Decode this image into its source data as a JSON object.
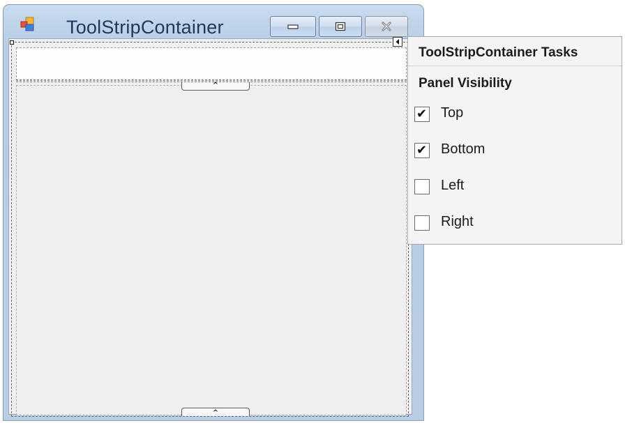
{
  "window": {
    "title": "ToolStripContainer",
    "icon": "form-icon"
  },
  "caption_buttons": {
    "minimize_icon": "minimize-icon",
    "maximize_icon": "maximize-icon",
    "close_icon": "close-icon"
  },
  "designer": {
    "top_expander_icon": "chevron-up-icon",
    "bottom_expander_icon": "chevron-up-icon",
    "smart_tag_icon": "smart-tag-collapse-icon"
  },
  "tasks_panel": {
    "title": "ToolStripContainer Tasks",
    "section_title": "Panel Visibility",
    "options": [
      {
        "label": "Top",
        "checked": true
      },
      {
        "label": "Bottom",
        "checked": true
      },
      {
        "label": "Left",
        "checked": false
      },
      {
        "label": "Right",
        "checked": false
      }
    ]
  },
  "colors": {
    "title_text": "#1e395b",
    "window_frame": "#bcd1e8",
    "client_background": "#f0f0f0",
    "tasks_background": "#f4f4f4"
  }
}
